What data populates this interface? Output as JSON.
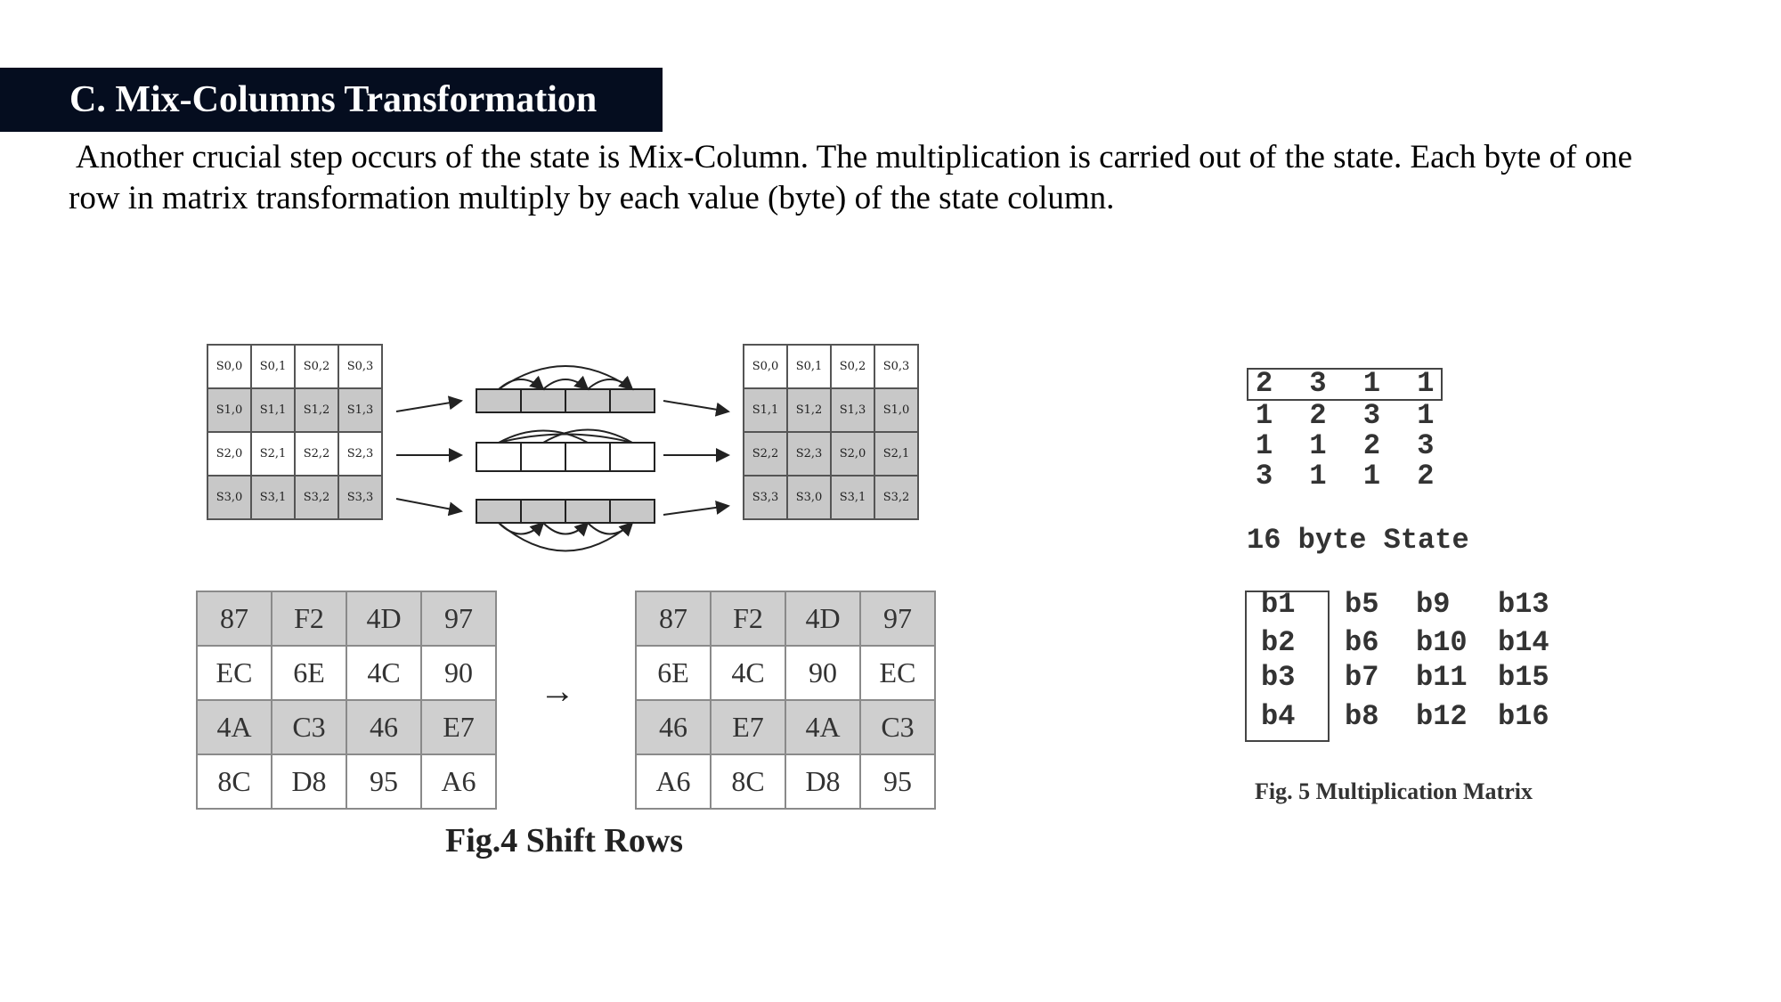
{
  "section": {
    "title": "C. Mix-Columns Transformation",
    "paragraph_line1": "Another crucial step occurs of the state is Mix-Column. The multiplication is carried out of the state. Each byte of one",
    "paragraph_line2": "row in matrix transformation multiply by each value (byte) of the state column."
  },
  "fig4": {
    "caption": "Fig.4 Shift Rows",
    "state_before": [
      [
        "S0,0",
        "S0,1",
        "S0,2",
        "S0,3"
      ],
      [
        "S1,0",
        "S1,1",
        "S1,2",
        "S1,3"
      ],
      [
        "S2,0",
        "S2,1",
        "S2,2",
        "S2,3"
      ],
      [
        "S3,0",
        "S3,1",
        "S3,2",
        "S3,3"
      ]
    ],
    "state_after": [
      [
        "S0,0",
        "S0,1",
        "S0,2",
        "S0,3"
      ],
      [
        "S1,1",
        "S1,2",
        "S1,3",
        "S1,0"
      ],
      [
        "S2,2",
        "S2,3",
        "S2,0",
        "S2,1"
      ],
      [
        "S3,3",
        "S3,0",
        "S3,1",
        "S3,2"
      ]
    ],
    "bytes_before": [
      [
        "87",
        "F2",
        "4D",
        "97"
      ],
      [
        "EC",
        "6E",
        "4C",
        "90"
      ],
      [
        "4A",
        "C3",
        "46",
        "E7"
      ],
      [
        "8C",
        "D8",
        "95",
        "A6"
      ]
    ],
    "bytes_after": [
      [
        "87",
        "F2",
        "4D",
        "97"
      ],
      [
        "6E",
        "4C",
        "90",
        "EC"
      ],
      [
        "46",
        "E7",
        "4A",
        "C3"
      ],
      [
        "A6",
        "8C",
        "D8",
        "95"
      ]
    ],
    "arrow": "→"
  },
  "fig5": {
    "caption": "Fig. 5 Multiplication Matrix",
    "matrix": [
      "2 3 1 1",
      "1 2 3 1",
      "1 1 2 3",
      "3 1 1 2"
    ],
    "state_label": "16 byte State",
    "state_rows": [
      [
        "b1",
        "b5",
        "b9",
        "b13"
      ],
      [
        "b2",
        "b6",
        "b10",
        "b14"
      ],
      [
        "b3",
        "b7",
        "b11",
        "b15"
      ],
      [
        "b4",
        "b8",
        "b12",
        "b16"
      ]
    ]
  }
}
